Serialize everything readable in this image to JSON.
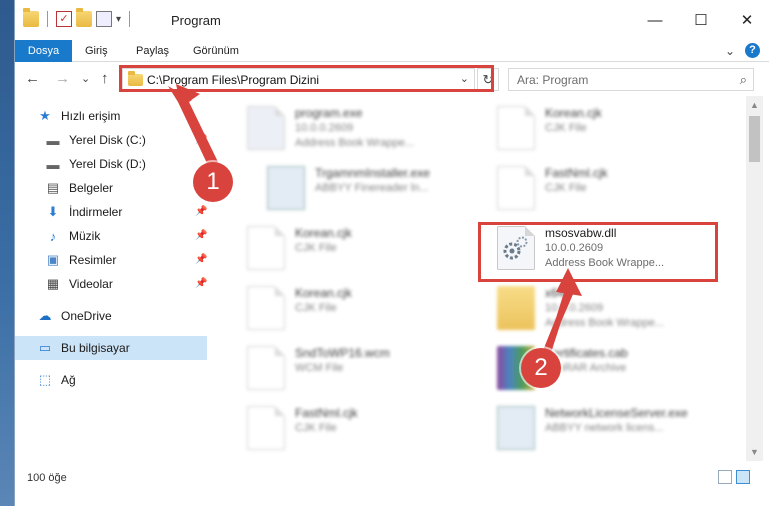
{
  "window": {
    "title": "Program",
    "qat_dropdown": "▾",
    "controls": {
      "minimize": "—",
      "maximize": "☐",
      "close": "✕"
    }
  },
  "ribbon": {
    "tabs": [
      {
        "label": "Dosya",
        "active": true
      },
      {
        "label": "Giriş"
      },
      {
        "label": "Paylaş"
      },
      {
        "label": "Görünüm"
      }
    ],
    "expand": "⌄",
    "help": "?"
  },
  "nav": {
    "back": "←",
    "forward": "→",
    "recent": "⌄",
    "up": "↑",
    "address": "C:\\Program Files\\Program Dizini",
    "address_dropdown": "⌄",
    "refresh": "↻",
    "search_placeholder": "Ara: Program",
    "search_icon": "search-icon"
  },
  "sidebar": {
    "items": [
      {
        "label": "Hızlı erişim",
        "icon": "star-icon",
        "glyph": "★"
      },
      {
        "label": "Yerel Disk (C:)",
        "icon": "drive-icon",
        "glyph": "▬",
        "pinned": true
      },
      {
        "label": "Yerel Disk (D:)",
        "icon": "drive-icon",
        "glyph": "▬",
        "pinned": true
      },
      {
        "label": "Belgeler",
        "icon": "documents-icon",
        "glyph": "▤",
        "pinned": true
      },
      {
        "label": "İndirmeler",
        "icon": "download-icon",
        "glyph": "⬇",
        "pinned": true
      },
      {
        "label": "Müzik",
        "icon": "music-icon",
        "glyph": "♪",
        "pinned": true
      },
      {
        "label": "Resimler",
        "icon": "pictures-icon",
        "glyph": "▣",
        "pinned": true
      },
      {
        "label": "Videolar",
        "icon": "videos-icon",
        "glyph": "▦",
        "pinned": true
      },
      {
        "label": "OneDrive",
        "icon": "cloud-icon",
        "glyph": "☁"
      },
      {
        "label": "Bu bilgisayar",
        "icon": "computer-icon",
        "glyph": "▭",
        "selected": true
      },
      {
        "label": "Ağ",
        "icon": "network-icon",
        "glyph": "⬚"
      }
    ],
    "pin_glyph": "📌"
  },
  "files": [
    {
      "name": "program.exe",
      "line2": "10.0.0.2609",
      "line3": "Address Book Wrappe...",
      "kind": "exe",
      "blurred": true
    },
    {
      "name": "Korean.cjk",
      "line2": "CJK File",
      "line3": "",
      "kind": "doc",
      "blurred": true
    },
    {
      "name": "TrgamnmInstaller.exe",
      "line2": "ABBYY Finereader ln...",
      "line3": "",
      "kind": "app",
      "blurred": true
    },
    {
      "name": "FastNml.cjk",
      "line2": "CJK File",
      "line3": "",
      "kind": "doc",
      "blurred": true
    },
    {
      "name": "Korean.cjk",
      "line2": "CJK File",
      "line3": "",
      "kind": "doc",
      "blurred": true
    },
    {
      "name": "msosvabw.dll",
      "line2": "10.0.0.2609",
      "line3": "Address Book Wrappe...",
      "kind": "dll",
      "blurred": false
    },
    {
      "name": "Korean.cjk",
      "line2": "CJK File",
      "line3": "",
      "kind": "doc",
      "blurred": true
    },
    {
      "name": "x64",
      "line2": "10.0.0.2609",
      "line3": "Address Book Wrappe...",
      "kind": "folder",
      "blurred": true
    },
    {
      "name": "SndToWP16.wcm",
      "line2": "WCM File",
      "line3": "",
      "kind": "doc",
      "blurred": true
    },
    {
      "name": "Certificates.cab",
      "line2": "WinRAR Archive",
      "line3": "",
      "kind": "rar",
      "blurred": true
    },
    {
      "name": "FastNml.cjk",
      "line2": "CJK File",
      "line3": "",
      "kind": "doc",
      "blurred": true
    },
    {
      "name": "NetworkLicenseServer.exe",
      "line2": "ABBYY network licens...",
      "line3": "",
      "kind": "app",
      "blurred": true
    }
  ],
  "status": {
    "count": "100 öğe"
  },
  "annotations": {
    "step1": "1",
    "step2": "2",
    "highlight_color": "#d9433d"
  }
}
